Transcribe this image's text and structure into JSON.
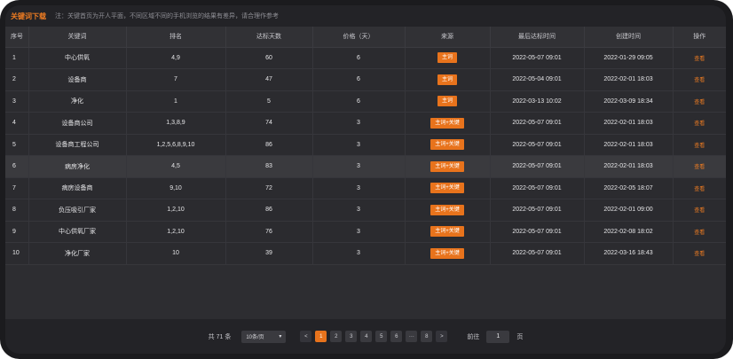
{
  "topbar": {
    "download_label": "关键词下载",
    "note": "注：关键首页为开人平面，不同区域不同的手机浏览的结果有差异，请合理作参考"
  },
  "table": {
    "columns": [
      "序号",
      "关键词",
      "排名",
      "达标天数",
      "价格（天）",
      "来源",
      "最后达标时间",
      "创建时间",
      "操作"
    ],
    "rows": [
      {
        "idx": "1",
        "keyword": "中心供氧",
        "rank": "4,9",
        "days": "60",
        "price": "6",
        "source": "主词",
        "last": "2022-05-07 09:01",
        "created": "2022-01-29 09:05",
        "op": "查看"
      },
      {
        "idx": "2",
        "keyword": "设备商",
        "rank": "7",
        "days": "47",
        "price": "6",
        "source": "主词",
        "last": "2022-05-04 09:01",
        "created": "2022-02-01 18:03",
        "op": "查看"
      },
      {
        "idx": "3",
        "keyword": "净化",
        "rank": "1",
        "days": "5",
        "price": "6",
        "source": "主词",
        "last": "2022-03-13 10:02",
        "created": "2022-03-09 18:34",
        "op": "查看"
      },
      {
        "idx": "4",
        "keyword": "设备商公司",
        "rank": "1,3,8,9",
        "days": "74",
        "price": "3",
        "source": "主词+关键",
        "last": "2022-05-07 09:01",
        "created": "2022-02-01 18:03",
        "op": "查看"
      },
      {
        "idx": "5",
        "keyword": "设备商工程公司",
        "rank": "1,2,5,6,8,9,10",
        "days": "86",
        "price": "3",
        "source": "主词+关键",
        "last": "2022-05-07 09:01",
        "created": "2022-02-01 18:03",
        "op": "查看"
      },
      {
        "idx": "6",
        "keyword": "病房净化",
        "rank": "4,5",
        "days": "83",
        "price": "3",
        "source": "主词+关键",
        "last": "2022-05-07 09:01",
        "created": "2022-02-01 18:03",
        "op": "查看"
      },
      {
        "idx": "7",
        "keyword": "病房设备商",
        "rank": "9,10",
        "days": "72",
        "price": "3",
        "source": "主词+关键",
        "last": "2022-05-07 09:01",
        "created": "2022-02-05 18:07",
        "op": "查看"
      },
      {
        "idx": "8",
        "keyword": "负压吸引厂家",
        "rank": "1,2,10",
        "days": "86",
        "price": "3",
        "source": "主词+关键",
        "last": "2022-05-07 09:01",
        "created": "2022-02-01 09:00",
        "op": "查看"
      },
      {
        "idx": "9",
        "keyword": "中心供氧厂家",
        "rank": "1,2,10",
        "days": "76",
        "price": "3",
        "source": "主词+关键",
        "last": "2022-05-07 09:01",
        "created": "2022-02-08 18:02",
        "op": "查看"
      },
      {
        "idx": "10",
        "keyword": "净化厂家",
        "rank": "10",
        "days": "39",
        "price": "3",
        "source": "主词+关键",
        "last": "2022-05-07 09:01",
        "created": "2022-03-16 18:43",
        "op": "查看"
      }
    ]
  },
  "pagination": {
    "total_prefix": "共 71 条",
    "page_size": "10条/页",
    "prev": "<",
    "pages": [
      "1",
      "2",
      "3",
      "4",
      "5",
      "6",
      "···",
      "8"
    ],
    "active_page": "1",
    "next": ">",
    "jump_label": "前往",
    "jump_value": "1",
    "page_unit": "页"
  },
  "colors": {
    "accent": "#e8731c",
    "background": "#2d2d31",
    "highlight_row": "#3a3a3e"
  }
}
